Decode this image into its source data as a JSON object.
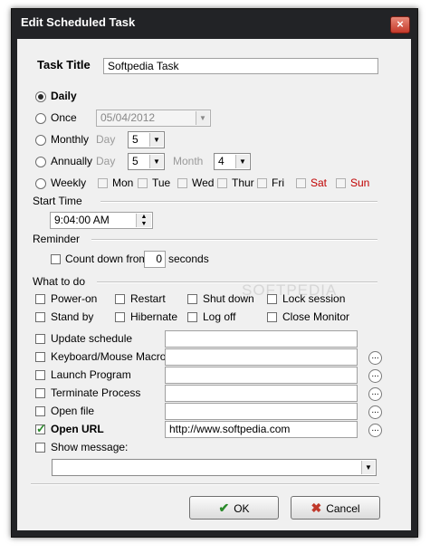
{
  "window": {
    "title": "Edit Scheduled Task",
    "close_glyph": "×"
  },
  "task_title": {
    "label": "Task Title",
    "value": "Softpedia Task"
  },
  "schedule": {
    "daily": "Daily",
    "once": "Once",
    "once_date": "05/04/2012",
    "monthly": "Monthly",
    "monthly_day_label": "Day",
    "monthly_day": "5",
    "annually": "Annually",
    "annually_day_label": "Day",
    "annually_day": "5",
    "annually_month_label": "Month",
    "annually_month": "4",
    "weekly": "Weekly",
    "days": {
      "mon": "Mon",
      "tue": "Tue",
      "wed": "Wed",
      "thu": "Thur",
      "fri": "Fri",
      "sat": "Sat",
      "sun": "Sun"
    },
    "selected": "Daily"
  },
  "start_time": {
    "label": "Start Time",
    "value": "9:04:00 AM"
  },
  "reminder": {
    "label": "Reminder",
    "countdown_label": "Count down from",
    "countdown_value": "0",
    "unit": "seconds"
  },
  "actions": {
    "label": "What to do",
    "power_on": "Power-on",
    "restart": "Restart",
    "shut_down": "Shut down",
    "lock_session": "Lock session",
    "stand_by": "Stand by",
    "hibernate": "Hibernate",
    "log_off": "Log off",
    "close_monitor": "Close Monitor",
    "update_schedule": "Update schedule",
    "keyboard_macro": "Keyboard/Mouse Macro",
    "launch_program": "Launch Program",
    "terminate_process": "Terminate Process",
    "open_file": "Open file",
    "open_url": "Open URL",
    "open_url_value": "http://www.softpedia.com",
    "show_message": "Show message:"
  },
  "buttons": {
    "ok": "OK",
    "cancel": "Cancel"
  },
  "watermark": "SOFTPEDIA",
  "colors": {
    "titlebar": "#222326",
    "dialog_bg": "#f0f0f0",
    "ok_check": "#2a8a2a",
    "cancel_x": "#c0392b",
    "weekend": "#c00000"
  }
}
